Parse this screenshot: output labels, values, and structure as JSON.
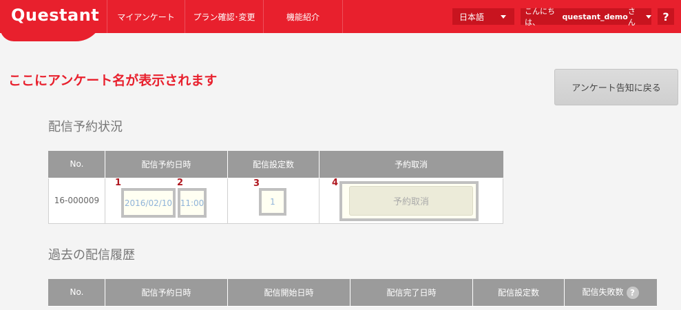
{
  "header": {
    "logo": "Questant",
    "nav": [
      "マイアンケート",
      "プラン確認･変更",
      "機能紹介"
    ],
    "language": "日本語",
    "greeting_prefix": "こんにちは、",
    "username": "questant_demo",
    "greeting_suffix": "さん",
    "help": "?"
  },
  "main": {
    "title": "ここにアンケート名が表示されます",
    "back_button": "アンケート告知に戻る",
    "reservation": {
      "heading": "配信予約状況",
      "columns": [
        "No.",
        "配信予約日時",
        "配信設定数",
        "予約取消"
      ],
      "row": {
        "no": "16-000009",
        "date": "2016/02/10",
        "time": "11:00",
        "count": "1",
        "cancel_label": "予約取消"
      },
      "markers": [
        "1",
        "2",
        "3",
        "4"
      ]
    },
    "history": {
      "heading": "過去の配信履歴",
      "columns": [
        "No.",
        "配信予約日時",
        "配信開始日時",
        "配信完了日時",
        "配信設定数",
        "配信失敗数"
      ],
      "help": "?"
    }
  },
  "colors": {
    "brand_red": "#e8202d",
    "header_dark": "#c8141f",
    "table_header": "#9b9b9b"
  }
}
